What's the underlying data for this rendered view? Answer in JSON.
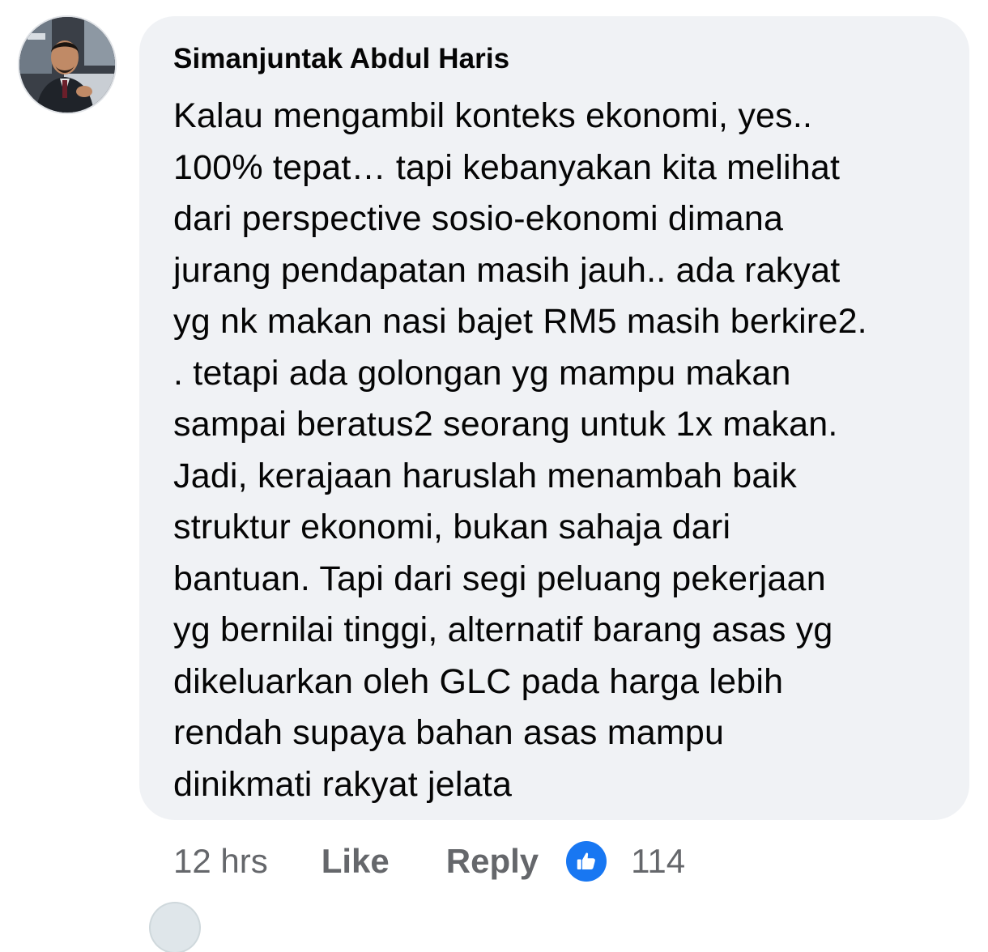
{
  "comment": {
    "author": "Simanjuntak Abdul Haris",
    "lines": [
      "Kalau mengambil konteks ekonomi, yes..",
      "100% tepat… tapi kebanyakan kita melihat",
      "dari perspective sosio-ekonomi dimana",
      "jurang pendapatan masih jauh.. ada rakyat",
      "yg nk makan nasi bajet RM5 masih berkire2.",
      ". tetapi ada golongan yg mampu makan",
      "sampai beratus2 seorang untuk 1x makan.",
      "Jadi, kerajaan haruslah menambah baik",
      "struktur ekonomi, bukan sahaja dari",
      "bantuan. Tapi dari segi peluang pekerjaan",
      "yg bernilai tinggi, alternatif barang asas yg",
      "dikeluarkan oleh GLC pada harga lebih",
      "rendah supaya bahan asas mampu",
      "dinikmati rakyat jelata"
    ]
  },
  "actions": {
    "timestamp": "12 hrs",
    "like_label": "Like",
    "reply_label": "Reply",
    "reaction_count": "114",
    "reaction_icon": "thumbs-up-icon"
  },
  "colors": {
    "bubble_bg": "#f0f2f5",
    "text": "#050505",
    "secondary_text": "#65676b",
    "like_blue": "#1877f2"
  }
}
